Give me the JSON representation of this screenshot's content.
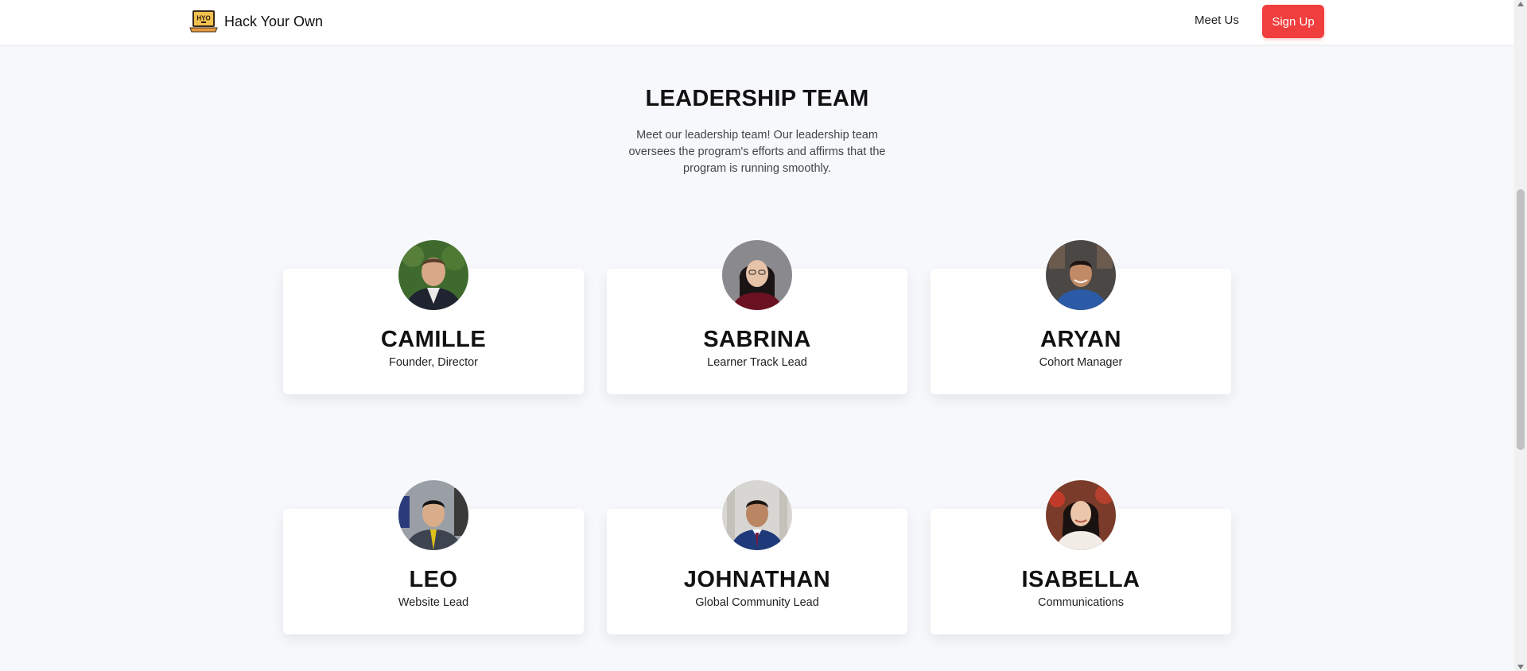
{
  "header": {
    "brand_name": "Hack Your Own",
    "logo_text": "HYO",
    "nav_meet_us": "Meet Us",
    "signup_label": "Sign Up"
  },
  "section": {
    "title": "LEADERSHIP TEAM",
    "description": "Meet our leadership team! Our leadership team oversees the program's efforts and affirms that the program is running smoothly."
  },
  "members": [
    {
      "name": "CAMILLE",
      "role": "Founder, Director"
    },
    {
      "name": "SABRINA",
      "role": "Learner Track Lead"
    },
    {
      "name": "ARYAN",
      "role": "Cohort Manager"
    },
    {
      "name": "LEO",
      "role": "Website Lead"
    },
    {
      "name": "JOHNATHAN",
      "role": "Global Community Lead"
    },
    {
      "name": "ISABELLA",
      "role": "Communications"
    }
  ],
  "colors": {
    "accent": "#f03e3e",
    "page_background": "#f6f8fb",
    "card_background": "#ffffff"
  }
}
